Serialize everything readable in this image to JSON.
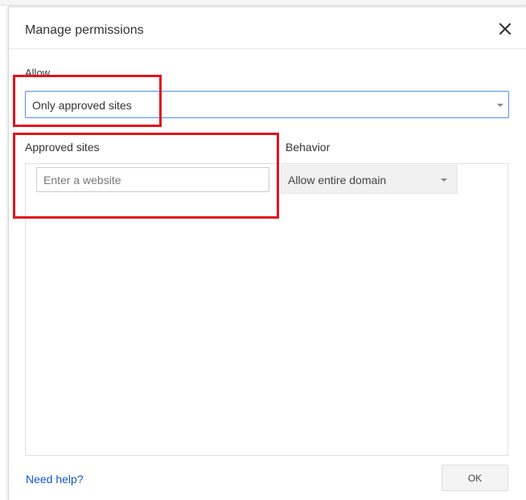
{
  "background": {
    "faint_text": ""
  },
  "dialog": {
    "title": "Manage permissions",
    "close_icon": "close-icon"
  },
  "allow": {
    "label": "Allow",
    "selected": "Only approved sites"
  },
  "approved_sites": {
    "label": "Approved sites",
    "input_placeholder": "Enter a website",
    "input_value": ""
  },
  "behavior": {
    "label": "Behavior",
    "selected": "Allow entire domain"
  },
  "footer": {
    "help_link": "Need help?",
    "ok_label": "OK"
  },
  "colors": {
    "accent_border": "#4d90fe",
    "link": "#1155cc",
    "annotation_red": "#e0141e"
  }
}
